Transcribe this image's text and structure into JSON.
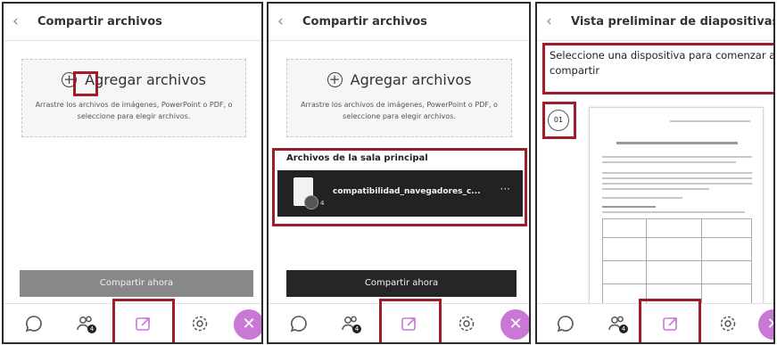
{
  "panel1": {
    "title": "Compartir archivos",
    "add_label": "Agregar archivos",
    "drop_hint": "Arrastre los archivos de imágenes, PowerPoint o PDF, o seleccione para elegir archivos.",
    "share_button": "Compartir ahora"
  },
  "panel2": {
    "title": "Compartir archivos",
    "add_label": "Agregar archivos",
    "drop_hint": "Arrastre los archivos de imágenes, PowerPoint o PDF, o seleccione para elegir archivos.",
    "section_title": "Archivos de la sala principal",
    "file_name": "compatibilidad_navegadores_c...",
    "file_count": "4",
    "file_menu": "···",
    "share_button": "Compartir ahora"
  },
  "panel3": {
    "title": "Vista preliminar de diapositivas",
    "instruction": "Seleccione una dispositiva para comenzar a compartir",
    "slide_number": "01"
  },
  "toolbar": {
    "items": [
      {
        "icon": "chat-icon"
      },
      {
        "icon": "attendees-icon",
        "badge": "4"
      },
      {
        "icon": "share-content-icon"
      },
      {
        "icon": "settings-icon"
      },
      {
        "icon": "close-icon",
        "label": "✕"
      }
    ],
    "accent": "#c978d6",
    "active_color": "#c978d6"
  },
  "colors": {
    "highlight": "#a01c2b",
    "share_disabled": "#888888",
    "share_enabled": "#262626"
  }
}
